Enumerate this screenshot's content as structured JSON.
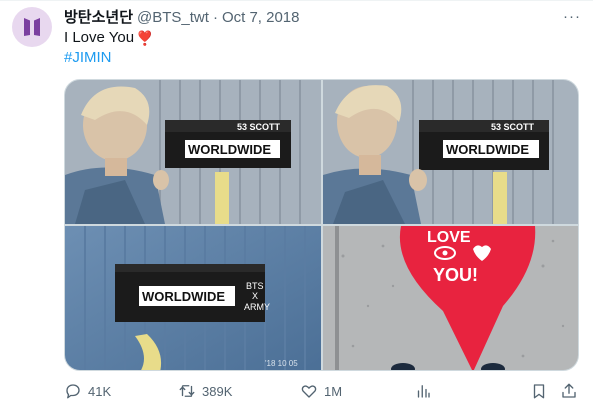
{
  "tweet": {
    "display_name": "방탄소년단",
    "handle": "@BTS_twt",
    "separator": "·",
    "date": "Oct 7, 2018",
    "text": "I Love You",
    "heart_emoji": "❣️",
    "hashtag": "#JIMIN",
    "more": "···"
  },
  "media": {
    "photo1": {
      "sign_top": "53 SCOTT",
      "sign_main": "WORLDWIDE"
    },
    "photo2": {
      "sign_top": "53 SCOTT",
      "sign_main": "WORLDWIDE"
    },
    "photo3": {
      "sign_main": "WORLDWIDE",
      "note_line1": "BTS",
      "note_line2": "X",
      "note_line3": "ARMY",
      "timestamp": "'18 10 05"
    },
    "photo4": {
      "line1": "LOVE",
      "line2": "YOU!"
    }
  },
  "actions": {
    "replies": "41K",
    "retweets": "389K",
    "likes": "1M"
  },
  "colors": {
    "link": "#1d9bf0",
    "muted": "#536471",
    "heart": "#e0245e",
    "avatar_bg": "#e8d8ef",
    "avatar_logo": "#7b3fa0"
  }
}
